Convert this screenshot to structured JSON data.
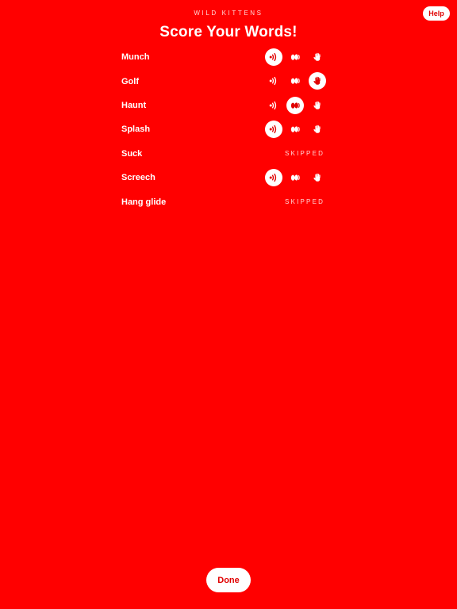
{
  "header": {
    "app_label": "WILD KITTENS",
    "help_label": "Help",
    "title": "Score Your Words!"
  },
  "icons": {
    "sound": "sound-wave-icon",
    "hands": "clapping-hands-icon",
    "hand": "raised-hand-icon"
  },
  "colors": {
    "background": "#ff0000",
    "accent_text": "#e00000",
    "muted_text": "#ffd6d6",
    "foreground": "#ffffff"
  },
  "words": [
    {
      "label": "Munch",
      "selected": 0,
      "skipped": false
    },
    {
      "label": "Golf",
      "selected": 2,
      "skipped": false
    },
    {
      "label": "Haunt",
      "selected": 1,
      "skipped": false
    },
    {
      "label": "Splash",
      "selected": 0,
      "skipped": false
    },
    {
      "label": "Suck",
      "selected": null,
      "skipped": true
    },
    {
      "label": "Screech",
      "selected": 0,
      "skipped": false
    },
    {
      "label": "Hang glide",
      "selected": null,
      "skipped": true
    }
  ],
  "skipped_label": "SKIPPED",
  "footer": {
    "done_label": "Done"
  }
}
